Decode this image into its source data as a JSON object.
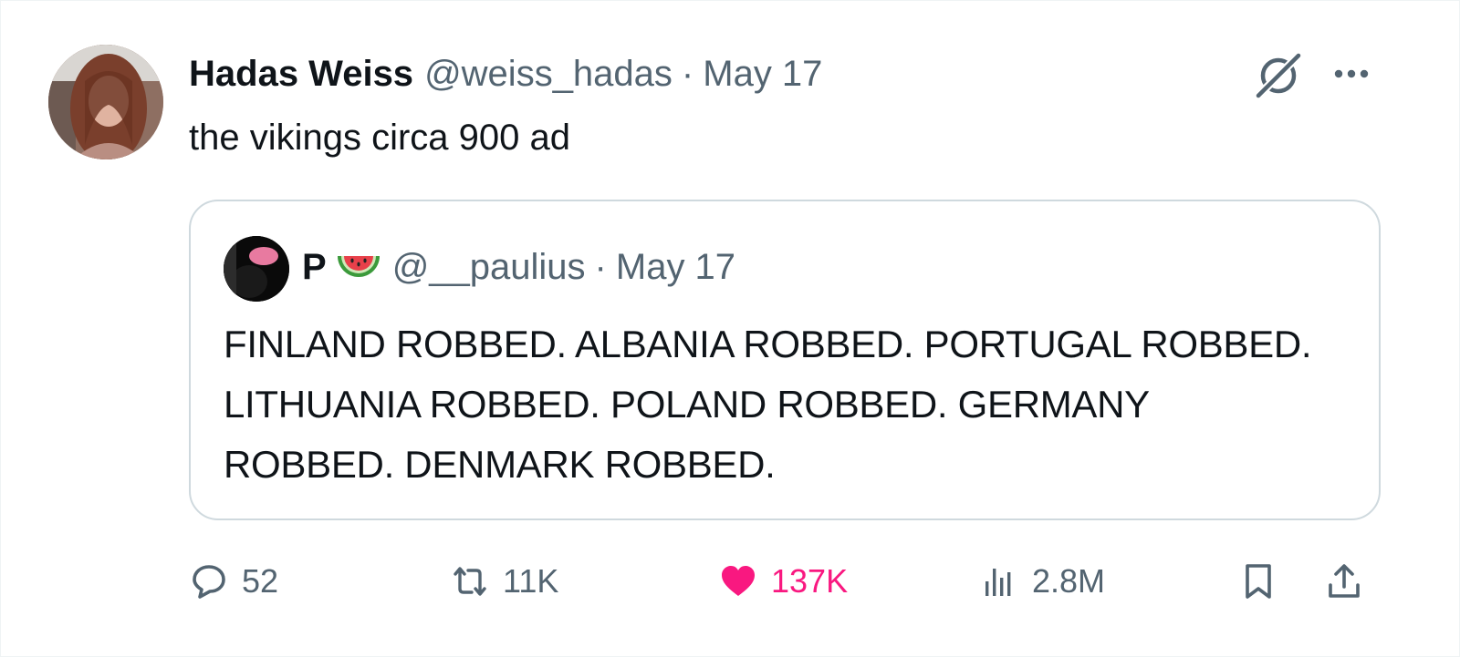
{
  "tweet": {
    "display_name": "Hadas Weiss",
    "handle": "@weiss_hadas",
    "separator": "·",
    "date": "May 17",
    "text": "the vikings circa 900 ad",
    "avatar_icon": "user-avatar-photo",
    "grok_icon": "grok-icon",
    "more_icon": "more-dots-icon"
  },
  "quote": {
    "display_name": "P",
    "emoji_icon": "watermelon-icon",
    "handle": "@__paulius",
    "separator": "·",
    "date": "May 17",
    "text": "FINLAND ROBBED. ALBANIA ROBBED. PORTUGAL ROBBED. LITHUANIA ROBBED. POLAND ROBBED. GERMANY ROBBED. DENMARK ROBBED."
  },
  "actions": {
    "replies": "52",
    "reposts": "11K",
    "likes": "137K",
    "views": "2.8M"
  },
  "colors": {
    "text_primary": "#0f1419",
    "text_secondary": "#536471",
    "like_pink": "#f91880",
    "border": "#cfd9de"
  }
}
